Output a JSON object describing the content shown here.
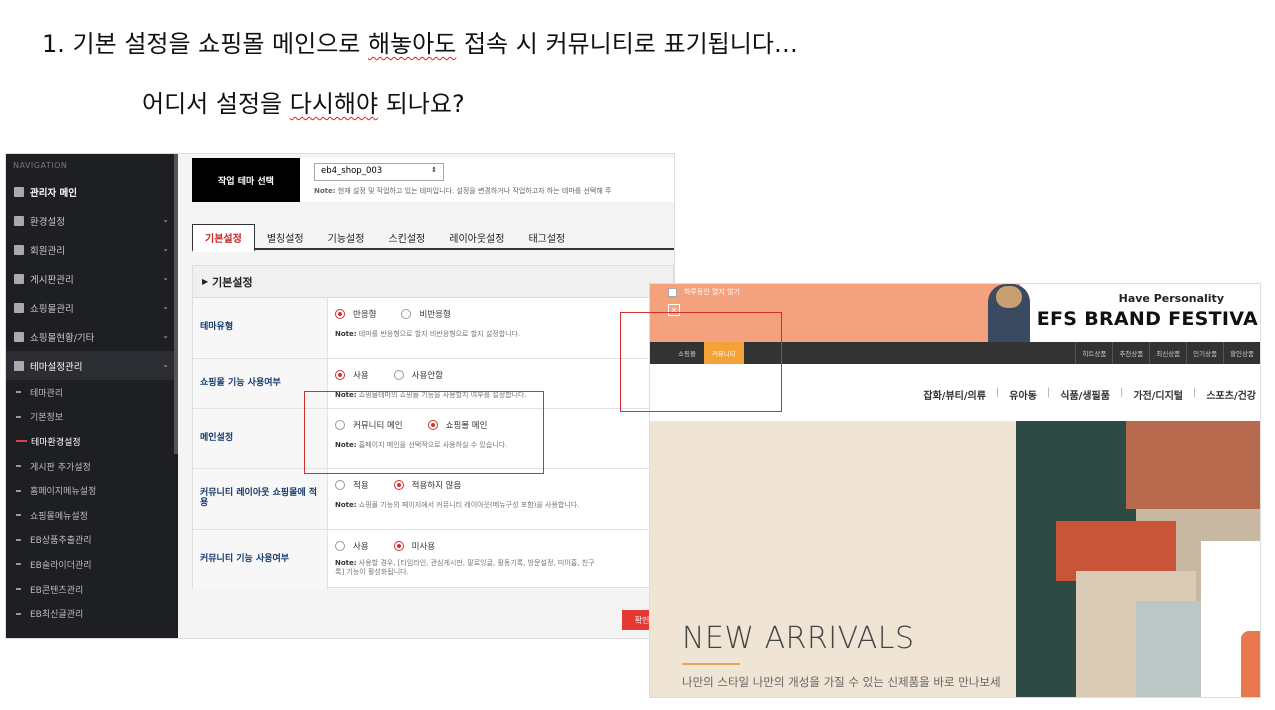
{
  "question": {
    "line1_a": "1.  기본 설정을 쇼핑몰 메인으로 ",
    "line1_squig": "해놓아도",
    "line1_b": " 접속 시 커뮤니티로 표기됩니다…",
    "line2_a": "어디서 설정을 ",
    "line2_squig": "다시해야",
    "line2_b": " 되나요?"
  },
  "admin": {
    "nav_title": "NAVIGATION",
    "nav_items": [
      {
        "label": "관리자 메인"
      },
      {
        "label": "환경설정"
      },
      {
        "label": "회원관리"
      },
      {
        "label": "게시판관리"
      },
      {
        "label": "쇼핑몰관리"
      },
      {
        "label": "쇼핑몰현황/기타"
      },
      {
        "label": "테마설정관리"
      }
    ],
    "sub_items": [
      "테마관리",
      "기본정보",
      "테마환경설정",
      "게시판 추가설정",
      "홈페이지메뉴설정",
      "쇼핑몰메뉴설정",
      "EB상품추출관리",
      "EB슬라이더관리",
      "EB콘텐츠관리",
      "EB최신글관리"
    ],
    "theme_label": "작업 테마 선택",
    "theme_value": "eb4_shop_003",
    "theme_note_b": "Note:",
    "theme_note": " 현재 설정 및 작업하고 있는 테마입니다. 설정을 변경하거나 작업하고자 하는 테마를 선택해 주",
    "tabs": [
      "기본설정",
      "별칭설정",
      "기능설정",
      "스킨설정",
      "레이아웃설정",
      "태그설정"
    ],
    "panel_title": "기본설정",
    "rows": [
      {
        "label": "테마유형",
        "opt1": "반응형",
        "opt2": "비반응형",
        "note": " 테마를 반응형으로 할지 비반응형으로 할지 설정합니다."
      },
      {
        "label": "쇼핑몰 기능 사용여부",
        "opt1": "사용",
        "opt2": "사용안함",
        "note": " 쇼핑몰테마의 쇼핑몰 기능을 사용할지 여부를 설정합니다."
      },
      {
        "label": "메인설정",
        "opt1": "커뮤니티 메인",
        "opt2": "쇼핑몰 메인",
        "note": " 홈페이지 메인을 선택적으로 사용하실 수 있습니다."
      },
      {
        "label": "커뮤니티 레이아웃 쇼핑몰에 적용",
        "opt1": "적용",
        "opt2": "적용하지 않음",
        "note": " 쇼핑몰 기능의 페이지에서 커뮤니티 레이아웃(메뉴구성 포함)을 사용합니다."
      },
      {
        "label": "커뮤니티 기능 사용여부",
        "opt1": "사용",
        "opt2": "미사용",
        "note": " 사용할 경우, [타임라인, 관심게시판, 팔로잉글, 활동기록, 방문설정, 미이홈, 친구",
        "note2": "록] 기능이 활성화됩니다."
      }
    ],
    "note_b": "Note:",
    "confirm": "확인"
  },
  "shop": {
    "popup_check": "하루동안 열지 않기",
    "close": "✕",
    "tagline": "Have Personality",
    "headline": "EFS BRAND FESTIVA",
    "nav_left": [
      "쇼핑몰",
      "커뮤니티"
    ],
    "nav_right": [
      "히트상품",
      "추천상품",
      "최신상품",
      "인기상품",
      "할인상품"
    ],
    "categories": [
      "잡화/뷰티/의류",
      "유아동",
      "식품/생필품",
      "가전/디지털",
      "스포츠/건강"
    ],
    "hero_title": "NEW ARRIVALS",
    "hero_sub": "나만의 스타일 나만의 개성을 가질 수 있는 신제품을 바로 만나보세요"
  }
}
